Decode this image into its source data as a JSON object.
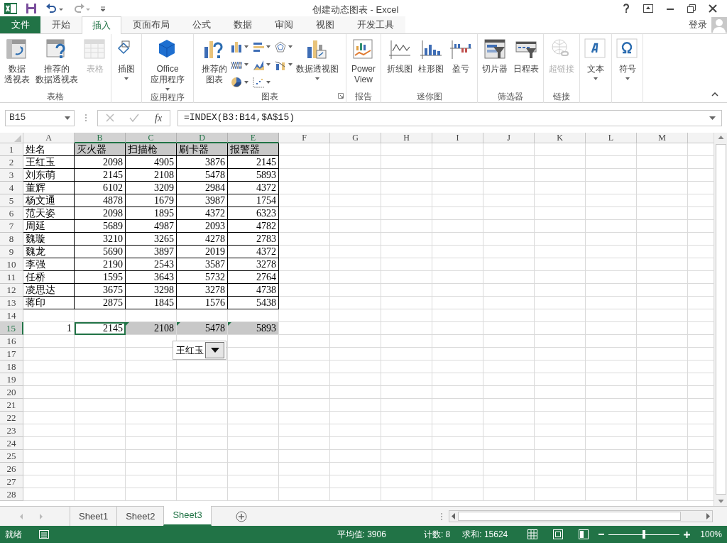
{
  "window": {
    "title": "创建动态图表 - Excel"
  },
  "tabs": [
    {
      "label": "文件",
      "kind": "file",
      "selected": false
    },
    {
      "label": "开始",
      "kind": "tab",
      "selected": false
    },
    {
      "label": "插入",
      "kind": "tab",
      "selected": true
    },
    {
      "label": "页面布局",
      "kind": "tab",
      "selected": false
    },
    {
      "label": "公式",
      "kind": "tab",
      "selected": false
    },
    {
      "label": "数据",
      "kind": "tab",
      "selected": false
    },
    {
      "label": "审阅",
      "kind": "tab",
      "selected": false
    },
    {
      "label": "视图",
      "kind": "tab",
      "selected": false
    },
    {
      "label": "开发工具",
      "kind": "tab",
      "selected": false
    }
  ],
  "sign_in": "登录",
  "ribbon": {
    "groups": [
      {
        "label": "表格",
        "items": [
          {
            "kind": "large",
            "lines": [
              "数据",
              "透视表"
            ],
            "dropdown": false,
            "disabled": false
          },
          {
            "kind": "large",
            "lines": [
              "推荐的",
              "数据透视表"
            ],
            "dropdown": false,
            "disabled": false
          },
          {
            "kind": "large",
            "lines": [
              "表格"
            ],
            "dropdown": false,
            "disabled": true
          }
        ]
      },
      {
        "items": [
          {
            "kind": "boxed",
            "lines": [
              "插图"
            ],
            "dropdown": true,
            "disabled": false
          }
        ]
      },
      {
        "label": "应用程序",
        "items": [
          {
            "kind": "large",
            "lines": [
              "Office",
              "应用程序"
            ],
            "dropdown": true,
            "disabled": false
          }
        ]
      },
      {
        "label": "图表",
        "launcher": true,
        "items": [
          {
            "kind": "large",
            "lines": [
              "推荐的",
              "图表"
            ],
            "dropdown": false,
            "disabled": false
          },
          {
            "kind": "gallery"
          },
          {
            "kind": "large",
            "lines": [
              "数据透视图"
            ],
            "dropdown": true,
            "disabled": false
          }
        ]
      },
      {
        "label": "报告",
        "items": [
          {
            "kind": "large",
            "lines": [
              "Power",
              "View"
            ],
            "dropdown": false,
            "disabled": false
          }
        ]
      },
      {
        "label": "迷你图",
        "items": [
          {
            "kind": "large",
            "lines": [
              "折线图"
            ],
            "dropdown": false,
            "disabled": false
          },
          {
            "kind": "large",
            "lines": [
              "柱形图"
            ],
            "dropdown": false,
            "disabled": false
          },
          {
            "kind": "large",
            "lines": [
              "盈亏"
            ],
            "dropdown": false,
            "disabled": false
          }
        ]
      },
      {
        "label": "筛选器",
        "items": [
          {
            "kind": "large",
            "lines": [
              "切片器"
            ],
            "dropdown": false,
            "disabled": false
          },
          {
            "kind": "large",
            "lines": [
              "日程表"
            ],
            "dropdown": false,
            "disabled": false
          }
        ]
      },
      {
        "label": "链接",
        "items": [
          {
            "kind": "large",
            "lines": [
              "超链接"
            ],
            "dropdown": false,
            "disabled": true
          }
        ]
      },
      {
        "items": [
          {
            "kind": "boxed",
            "lines": [
              "文本"
            ],
            "dropdown": true,
            "disabled": false
          }
        ]
      },
      {
        "items": [
          {
            "kind": "boxed",
            "lines": [
              "符号"
            ],
            "dropdown": true,
            "disabled": false
          }
        ]
      }
    ]
  },
  "formula_bar": {
    "name_box": "B15",
    "function_button": "fx",
    "formula": "=INDEX(B3:B14,$A$15)"
  },
  "sheet": {
    "columns": [
      {
        "label": "A",
        "selected": false
      },
      {
        "label": "B",
        "selected": true
      },
      {
        "label": "C",
        "selected": true
      },
      {
        "label": "D",
        "selected": true
      },
      {
        "label": "E",
        "selected": true
      },
      {
        "label": "F",
        "selected": false
      },
      {
        "label": "G",
        "selected": false
      },
      {
        "label": "H",
        "selected": false
      },
      {
        "label": "I",
        "selected": false
      },
      {
        "label": "J",
        "selected": false
      },
      {
        "label": "K",
        "selected": false
      },
      {
        "label": "L",
        "selected": false
      },
      {
        "label": "M",
        "selected": false
      }
    ],
    "rows": [
      {
        "number": "1",
        "selected": false,
        "boxed": true,
        "cells": [
          {
            "text": "姓名",
            "kind": "text"
          },
          {
            "text": "灭火器",
            "kind": "text",
            "shaded": true
          },
          {
            "text": "扫描枪",
            "kind": "text",
            "shaded": true
          },
          {
            "text": "刷卡器",
            "kind": "text",
            "shaded": true
          },
          {
            "text": "报警器",
            "kind": "text",
            "shaded": true
          }
        ]
      },
      {
        "number": "2",
        "selected": false,
        "boxed": true,
        "cells": [
          {
            "text": "王红玉",
            "kind": "text"
          },
          {
            "text": "2098",
            "kind": "number"
          },
          {
            "text": "4905",
            "kind": "number"
          },
          {
            "text": "3876",
            "kind": "number"
          },
          {
            "text": "2145",
            "kind": "number"
          }
        ]
      },
      {
        "number": "3",
        "selected": false,
        "boxed": true,
        "cells": [
          {
            "text": "刘东萌",
            "kind": "text"
          },
          {
            "text": "2145",
            "kind": "number"
          },
          {
            "text": "2108",
            "kind": "number"
          },
          {
            "text": "5478",
            "kind": "number"
          },
          {
            "text": "5893",
            "kind": "number"
          }
        ]
      },
      {
        "number": "4",
        "selected": false,
        "boxed": true,
        "cells": [
          {
            "text": "董辉",
            "kind": "text"
          },
          {
            "text": "6102",
            "kind": "number"
          },
          {
            "text": "3209",
            "kind": "number"
          },
          {
            "text": "2984",
            "kind": "number"
          },
          {
            "text": "4372",
            "kind": "number"
          }
        ]
      },
      {
        "number": "5",
        "selected": false,
        "boxed": true,
        "cells": [
          {
            "text": "杨文通",
            "kind": "text"
          },
          {
            "text": "4878",
            "kind": "number"
          },
          {
            "text": "1679",
            "kind": "number"
          },
          {
            "text": "3987",
            "kind": "number"
          },
          {
            "text": "1754",
            "kind": "number"
          }
        ]
      },
      {
        "number": "6",
        "selected": false,
        "boxed": true,
        "cells": [
          {
            "text": "范天姿",
            "kind": "text"
          },
          {
            "text": "2098",
            "kind": "number"
          },
          {
            "text": "1895",
            "kind": "number"
          },
          {
            "text": "4372",
            "kind": "number"
          },
          {
            "text": "6323",
            "kind": "number"
          }
        ]
      },
      {
        "number": "7",
        "selected": false,
        "boxed": true,
        "cells": [
          {
            "text": "周延",
            "kind": "text"
          },
          {
            "text": "5689",
            "kind": "number"
          },
          {
            "text": "4987",
            "kind": "number"
          },
          {
            "text": "2093",
            "kind": "number"
          },
          {
            "text": "4782",
            "kind": "number"
          }
        ]
      },
      {
        "number": "8",
        "selected": false,
        "boxed": true,
        "cells": [
          {
            "text": "魏璇",
            "kind": "text"
          },
          {
            "text": "3210",
            "kind": "number"
          },
          {
            "text": "3265",
            "kind": "number"
          },
          {
            "text": "4278",
            "kind": "number"
          },
          {
            "text": "2783",
            "kind": "number"
          }
        ]
      },
      {
        "number": "9",
        "selected": false,
        "boxed": true,
        "cells": [
          {
            "text": "魏龙",
            "kind": "text"
          },
          {
            "text": "5690",
            "kind": "number"
          },
          {
            "text": "3897",
            "kind": "number"
          },
          {
            "text": "2019",
            "kind": "number"
          },
          {
            "text": "4372",
            "kind": "number"
          }
        ]
      },
      {
        "number": "10",
        "selected": false,
        "boxed": true,
        "cells": [
          {
            "text": "李强",
            "kind": "text"
          },
          {
            "text": "2190",
            "kind": "number"
          },
          {
            "text": "2543",
            "kind": "number"
          },
          {
            "text": "3587",
            "kind": "number"
          },
          {
            "text": "3278",
            "kind": "number"
          }
        ]
      },
      {
        "number": "11",
        "selected": false,
        "boxed": true,
        "cells": [
          {
            "text": "任桥",
            "kind": "text"
          },
          {
            "text": "1595",
            "kind": "number"
          },
          {
            "text": "3643",
            "kind": "number"
          },
          {
            "text": "5732",
            "kind": "number"
          },
          {
            "text": "2764",
            "kind": "number"
          }
        ]
      },
      {
        "number": "12",
        "selected": false,
        "boxed": true,
        "cells": [
          {
            "text": "凌思达",
            "kind": "text"
          },
          {
            "text": "3675",
            "kind": "number"
          },
          {
            "text": "3298",
            "kind": "number"
          },
          {
            "text": "3278",
            "kind": "number"
          },
          {
            "text": "4738",
            "kind": "number"
          }
        ]
      },
      {
        "number": "13",
        "selected": false,
        "boxed": true,
        "cells": [
          {
            "text": "蒋印",
            "kind": "text"
          },
          {
            "text": "2875",
            "kind": "number"
          },
          {
            "text": "1845",
            "kind": "number"
          },
          {
            "text": "1576",
            "kind": "number"
          },
          {
            "text": "5438",
            "kind": "number"
          }
        ]
      },
      {
        "number": "14",
        "selected": false,
        "boxed": false
      },
      {
        "number": "15",
        "selected": true,
        "boxed": false,
        "cells": [
          {
            "text": "1",
            "kind": "number"
          },
          {
            "text": "2145",
            "kind": "number",
            "active": true
          },
          {
            "text": "2108",
            "kind": "number",
            "shaded": true,
            "flagged": true
          },
          {
            "text": "5478",
            "kind": "number",
            "shaded": true,
            "flagged": true
          },
          {
            "text": "5893",
            "kind": "number",
            "shaded": true,
            "flagged": true
          }
        ]
      },
      {
        "number": "16",
        "selected": false,
        "boxed": false
      },
      {
        "number": "17",
        "selected": false,
        "boxed": false
      },
      {
        "number": "18",
        "selected": false,
        "boxed": false
      },
      {
        "number": "19",
        "selected": false,
        "boxed": false
      },
      {
        "number": "20",
        "selected": false,
        "boxed": false
      },
      {
        "number": "21",
        "selected": false,
        "boxed": false
      },
      {
        "number": "22",
        "selected": false,
        "boxed": false
      },
      {
        "number": "23",
        "selected": false,
        "boxed": false
      },
      {
        "number": "24",
        "selected": false,
        "boxed": false
      },
      {
        "number": "25",
        "selected": false,
        "boxed": false
      },
      {
        "number": "26",
        "selected": false,
        "boxed": false
      },
      {
        "number": "27",
        "selected": false,
        "boxed": false
      },
      {
        "number": "28",
        "selected": false,
        "boxed": false
      }
    ]
  },
  "combo_box": {
    "value": "王红玉"
  },
  "sheet_tabs": [
    {
      "label": "Sheet1",
      "selected": false
    },
    {
      "label": "Sheet2",
      "selected": false
    },
    {
      "label": "Sheet3",
      "selected": true
    }
  ],
  "status_bar": {
    "mode": "就绪",
    "average": "平均值: 3906",
    "count": "计数: 8",
    "sum": "求和: 15624",
    "zoom": {
      "level": 0.5,
      "reading": "100%"
    }
  }
}
